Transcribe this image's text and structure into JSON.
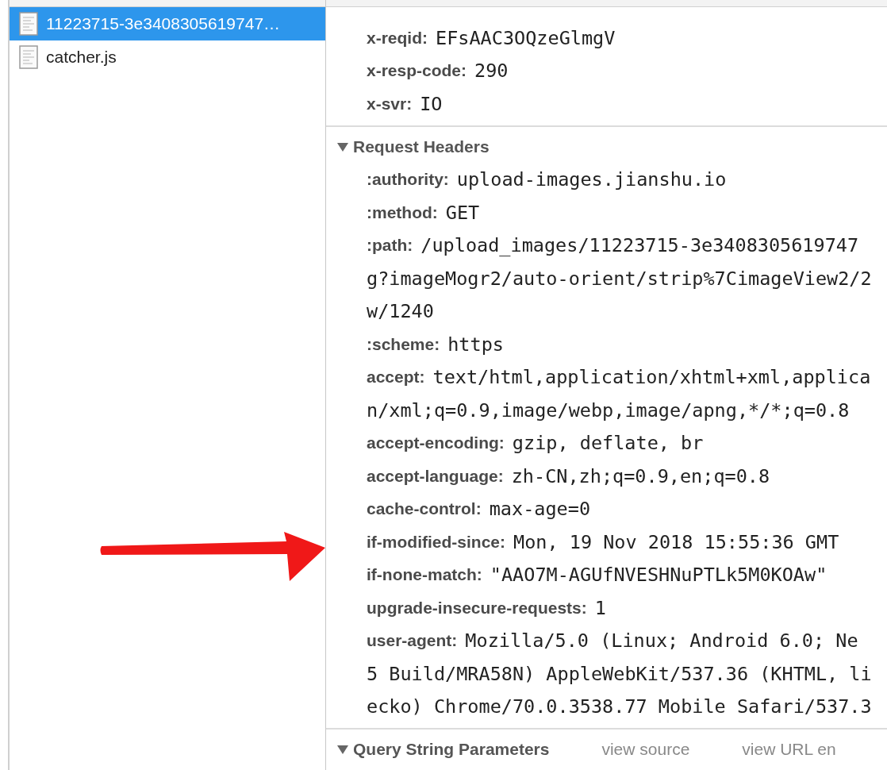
{
  "files": [
    {
      "name": "11223715-3e3408305619747…",
      "selected": true
    },
    {
      "name": "catcher.js",
      "selected": false
    }
  ],
  "sections": [
    {
      "kind": "plain",
      "headers": [
        {
          "name": "x-reqid:",
          "value": [
            "EFsAAC3OQzeGlmgV"
          ]
        },
        {
          "name": "x-resp-code:",
          "value": [
            "290"
          ]
        },
        {
          "name": "x-svr:",
          "value": [
            "IO"
          ]
        }
      ]
    },
    {
      "kind": "section",
      "title": "Request Headers",
      "expanded": true,
      "headers": [
        {
          "name": ":authority:",
          "value": [
            "upload-images.jianshu.io"
          ]
        },
        {
          "name": ":method:",
          "value": [
            "GET"
          ]
        },
        {
          "name": ":path:",
          "value": [
            "/upload_images/11223715-3e3408305619747",
            "g?imageMogr2/auto-orient/strip%7CimageView2/2",
            "w/1240"
          ]
        },
        {
          "name": ":scheme:",
          "value": [
            "https"
          ]
        },
        {
          "name": "accept:",
          "value": [
            "text/html,application/xhtml+xml,applica",
            "n/xml;q=0.9,image/webp,image/apng,*/*;q=0.8"
          ]
        },
        {
          "name": "accept-encoding:",
          "value": [
            "gzip, deflate, br"
          ]
        },
        {
          "name": "accept-language:",
          "value": [
            "zh-CN,zh;q=0.9,en;q=0.8"
          ]
        },
        {
          "name": "cache-control:",
          "value": [
            "max-age=0"
          ]
        },
        {
          "name": "if-modified-since:",
          "value": [
            "Mon, 19 Nov 2018 15:55:36 GMT"
          ]
        },
        {
          "name": "if-none-match:",
          "value": [
            "\"AAO7M-AGUfNVESHNuPTLk5M0KOAw\""
          ]
        },
        {
          "name": "upgrade-insecure-requests:",
          "value": [
            "1"
          ]
        },
        {
          "name": "user-agent:",
          "value": [
            "Mozilla/5.0 (Linux; Android 6.0; Ne",
            "5 Build/MRA58N) AppleWebKit/537.36 (KHTML, li",
            "ecko) Chrome/70.0.3538.77 Mobile Safari/537.3"
          ]
        }
      ]
    },
    {
      "kind": "section",
      "title": "Query String Parameters",
      "expanded": true,
      "links": [
        "view source",
        "view URL en"
      ]
    }
  ]
}
